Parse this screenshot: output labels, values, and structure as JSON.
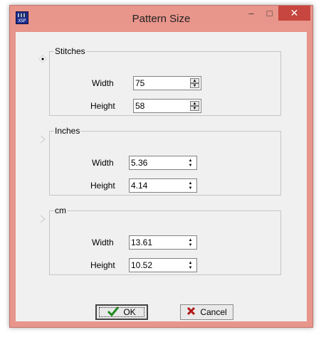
{
  "window": {
    "title": "Pattern Size",
    "app_icon_label": "XSP",
    "close_glyph": "✕",
    "maximize_glyph": "□",
    "minimize_glyph": "–"
  },
  "groups": [
    {
      "legend": "Stitches",
      "selected": true,
      "width_label": "Width",
      "width_value": "75",
      "height_label": "Height",
      "height_value": "58"
    },
    {
      "legend": "Inches",
      "selected": false,
      "width_label": "Width",
      "width_value": "5.36",
      "height_label": "Height",
      "height_value": "4.14"
    },
    {
      "legend": "cm",
      "selected": false,
      "width_label": "Width",
      "width_value": "13.61",
      "height_label": "Height",
      "height_value": "10.52"
    }
  ],
  "buttons": {
    "ok_label": "OK",
    "cancel_label": "Cancel"
  },
  "colors": {
    "titlebar": "#e8958b",
    "close_button": "#c7463f",
    "ok_check": "#1e8a1e",
    "cancel_x": "#b01818"
  }
}
